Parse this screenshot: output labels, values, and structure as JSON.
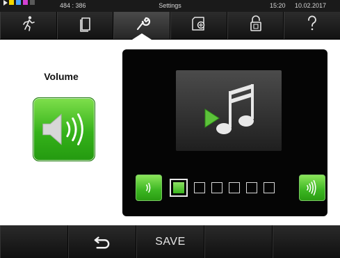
{
  "status_bar": {
    "coordinates": "484 : 386",
    "title": "Settings",
    "time": "15:20",
    "date": "10.02.2017",
    "indicator_colors": [
      "#f2d600",
      "#4aa3ff",
      "#d23fd2",
      "#5a5a5a"
    ]
  },
  "tabs": [
    {
      "name": "person-running-icon",
      "active": false
    },
    {
      "name": "document-icon",
      "active": false
    },
    {
      "name": "wrench-icon",
      "active": true
    },
    {
      "name": "device-settings-icon",
      "active": false
    },
    {
      "name": "padlock-icon",
      "active": false
    },
    {
      "name": "help-icon",
      "active": false
    }
  ],
  "main": {
    "heading": "Volume",
    "volume_level": 1,
    "volume_levels_total": 6,
    "accent_color": "#3cb622"
  },
  "bottom_bar": {
    "back_icon": "back-arrow-icon",
    "save_label": "SAVE"
  }
}
